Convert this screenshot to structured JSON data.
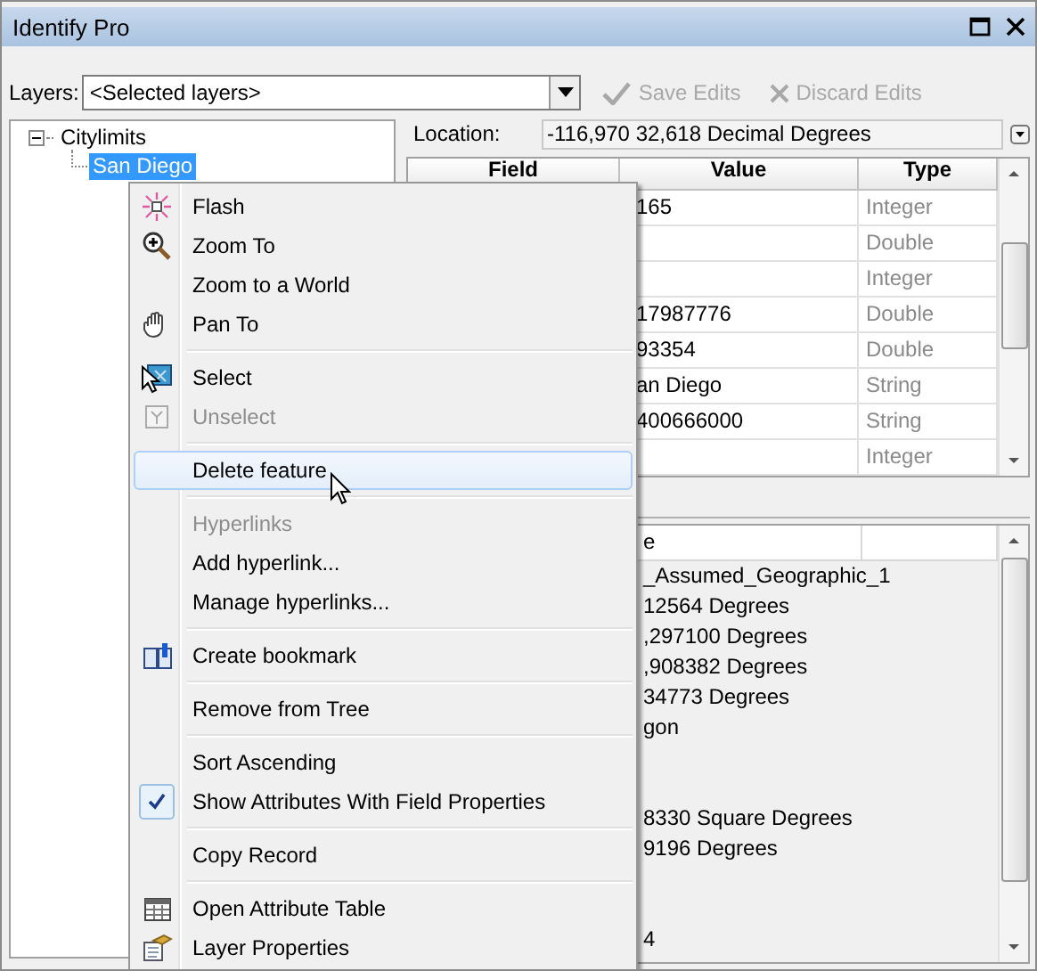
{
  "window": {
    "title": "Identify Pro"
  },
  "toolbar": {
    "layers_label": "Layers:",
    "layers_value": "<Selected layers>",
    "buttons": [
      {
        "label": "Save Edits",
        "disabled": true
      },
      {
        "label": "Discard Edits",
        "disabled": true
      }
    ]
  },
  "tree": [
    {
      "label": "Citylimits",
      "expanded": true,
      "selected": false,
      "children": [
        {
          "label": "San Diego",
          "selected": true
        }
      ]
    }
  ],
  "location": {
    "label": "Location:",
    "value": "-116,970  32,618 Decimal Degrees"
  },
  "attributes": {
    "columns": [
      "Field",
      "Value",
      "Type"
    ],
    "rows": [
      {
        "value": "165",
        "type": "Integer"
      },
      {
        "type": "Double"
      },
      {
        "type": "Integer"
      },
      {
        "value": "17987776",
        "type": "Double"
      },
      {
        "value": "93354",
        "type": "Double"
      },
      {
        "value": "an Diego",
        "type": "String"
      },
      {
        "value": "400666000",
        "type": "String"
      },
      {
        "type": "Integer"
      }
    ]
  },
  "details": {
    "column_2": "e",
    "rows": [
      {
        "value": "_Assumed_Geographic_1"
      },
      {
        "value": "12564 Degrees"
      },
      {
        "value": ",297100 Degrees"
      },
      {
        "value": ",908382 Degrees"
      },
      {
        "value": "34773 Degrees"
      },
      {
        "value": "gon"
      },
      {},
      {},
      {
        "value": "8330 Square Degrees"
      },
      {
        "value": "9196 Degrees"
      },
      {},
      {},
      {
        "value": "4"
      }
    ]
  },
  "context_menu": {
    "items": [
      {
        "kind": "item",
        "label": "Flash",
        "disabled": false,
        "selected": false,
        "checked": false
      },
      {
        "kind": "item",
        "label": "Zoom To",
        "disabled": false,
        "selected": false,
        "checked": false
      },
      {
        "kind": "item",
        "label": "Zoom to a World",
        "disabled": false,
        "selected": false,
        "checked": false
      },
      {
        "kind": "item",
        "label": "Pan To",
        "disabled": false,
        "selected": false,
        "checked": false
      },
      {
        "kind": "separator"
      },
      {
        "kind": "item",
        "label": "Select",
        "disabled": false,
        "selected": false,
        "checked": false
      },
      {
        "kind": "item",
        "label": "Unselect",
        "disabled": true,
        "selected": false,
        "checked": false
      },
      {
        "kind": "separator"
      },
      {
        "kind": "item",
        "label": "Delete feature",
        "disabled": false,
        "selected": true,
        "checked": false
      },
      {
        "kind": "separator"
      },
      {
        "kind": "item",
        "label": "Hyperlinks",
        "disabled": true,
        "selected": false,
        "checked": false
      },
      {
        "kind": "item",
        "label": "Add hyperlink...",
        "disabled": false,
        "selected": false,
        "checked": false
      },
      {
        "kind": "item",
        "label": "Manage hyperlinks...",
        "disabled": false,
        "selected": false,
        "checked": false
      },
      {
        "kind": "separator"
      },
      {
        "kind": "item",
        "label": "Create bookmark",
        "disabled": false,
        "selected": false,
        "checked": false
      },
      {
        "kind": "separator"
      },
      {
        "kind": "item",
        "label": "Remove from Tree",
        "disabled": false,
        "selected": false,
        "checked": false
      },
      {
        "kind": "separator"
      },
      {
        "kind": "item",
        "label": "Sort Ascending",
        "disabled": false,
        "selected": false,
        "checked": false
      },
      {
        "kind": "item",
        "label": "Show Attributes With Field Properties",
        "disabled": false,
        "selected": false,
        "checked": true
      },
      {
        "kind": "separator"
      },
      {
        "kind": "item",
        "label": "Copy Record",
        "disabled": false,
        "selected": false,
        "checked": false
      },
      {
        "kind": "separator"
      },
      {
        "kind": "item",
        "label": "Open Attribute Table",
        "disabled": false,
        "selected": false,
        "checked": false
      },
      {
        "kind": "item",
        "label": "Layer Properties",
        "disabled": false,
        "selected": false,
        "checked": false
      }
    ]
  }
}
